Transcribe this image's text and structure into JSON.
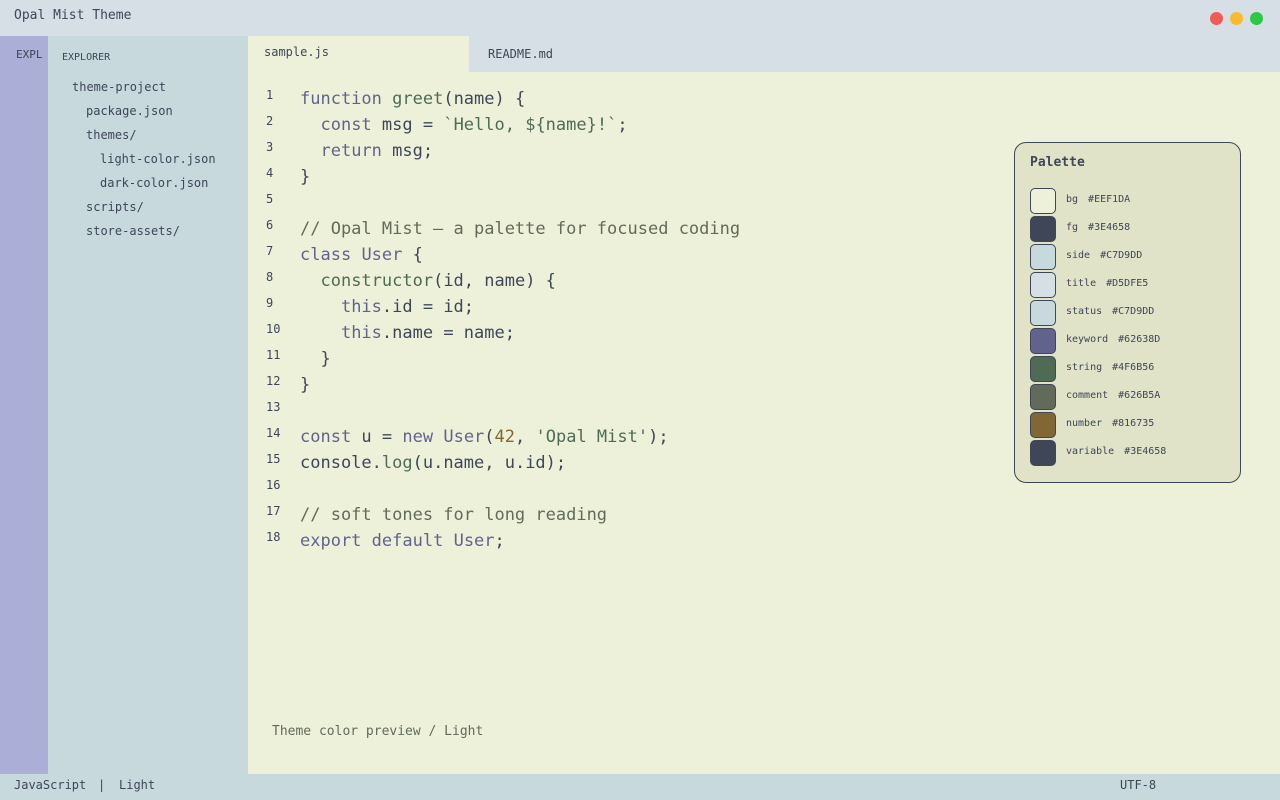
{
  "window": {
    "title": "Opal Mist Theme"
  },
  "activity_bar": {
    "label": "EXPL"
  },
  "sidebar": {
    "heading": "EXPLORER",
    "items": [
      {
        "label": "theme-project",
        "depth": 1
      },
      {
        "label": "package.json",
        "depth": 2
      },
      {
        "label": "themes/",
        "depth": 2
      },
      {
        "label": "light-color.json",
        "depth": 3
      },
      {
        "label": "dark-color.json",
        "depth": 3
      },
      {
        "label": "scripts/",
        "depth": 2
      },
      {
        "label": "store-assets/",
        "depth": 2
      }
    ]
  },
  "tabs": [
    {
      "label": "sample.js",
      "active": true
    },
    {
      "label": "README.md",
      "active": false
    }
  ],
  "editor": {
    "lines": [
      {
        "n": "1",
        "tokens": [
          [
            "keyword",
            "function"
          ],
          [
            "plain",
            " "
          ],
          [
            "func",
            "greet"
          ],
          [
            "plain",
            "(name) {"
          ]
        ]
      },
      {
        "n": "2",
        "tokens": [
          [
            "plain",
            "  "
          ],
          [
            "keyword",
            "const"
          ],
          [
            "plain",
            " msg = "
          ],
          [
            "string",
            "`Hello, ${name}!`"
          ],
          [
            "plain",
            ";"
          ]
        ]
      },
      {
        "n": "3",
        "tokens": [
          [
            "plain",
            "  "
          ],
          [
            "keyword",
            "return"
          ],
          [
            "plain",
            " msg;"
          ]
        ]
      },
      {
        "n": "4",
        "tokens": [
          [
            "plain",
            "}"
          ]
        ]
      },
      {
        "n": "5",
        "tokens": []
      },
      {
        "n": "6",
        "tokens": [
          [
            "comment",
            "// Opal Mist — a palette for focused coding"
          ]
        ]
      },
      {
        "n": "7",
        "tokens": [
          [
            "keyword",
            "class"
          ],
          [
            "plain",
            " "
          ],
          [
            "keyword",
            "User"
          ],
          [
            "plain",
            " {"
          ]
        ]
      },
      {
        "n": "8",
        "tokens": [
          [
            "plain",
            "  "
          ],
          [
            "func",
            "constructor"
          ],
          [
            "plain",
            "(id, name) {"
          ]
        ]
      },
      {
        "n": "9",
        "tokens": [
          [
            "plain",
            "    "
          ],
          [
            "keyword",
            "this"
          ],
          [
            "plain",
            ".id = id;"
          ]
        ]
      },
      {
        "n": "10",
        "tokens": [
          [
            "plain",
            "    "
          ],
          [
            "keyword",
            "this"
          ],
          [
            "plain",
            ".name = name;"
          ]
        ]
      },
      {
        "n": "11",
        "tokens": [
          [
            "plain",
            "  }"
          ]
        ]
      },
      {
        "n": "12",
        "tokens": [
          [
            "plain",
            "}"
          ]
        ]
      },
      {
        "n": "13",
        "tokens": []
      },
      {
        "n": "14",
        "tokens": [
          [
            "keyword",
            "const"
          ],
          [
            "plain",
            " u = "
          ],
          [
            "keyword",
            "new"
          ],
          [
            "plain",
            " "
          ],
          [
            "keyword",
            "User"
          ],
          [
            "plain",
            "("
          ],
          [
            "number",
            "42"
          ],
          [
            "plain",
            ", "
          ],
          [
            "string",
            "'Opal Mist'"
          ],
          [
            "plain",
            ");"
          ]
        ]
      },
      {
        "n": "15",
        "tokens": [
          [
            "plain",
            "console."
          ],
          [
            "func",
            "log"
          ],
          [
            "plain",
            "(u.name, u.id);"
          ]
        ]
      },
      {
        "n": "16",
        "tokens": []
      },
      {
        "n": "17",
        "tokens": [
          [
            "comment",
            "// soft tones for long reading"
          ]
        ]
      },
      {
        "n": "18",
        "tokens": [
          [
            "keyword",
            "export"
          ],
          [
            "plain",
            " "
          ],
          [
            "keyword",
            "default"
          ],
          [
            "plain",
            " "
          ],
          [
            "keyword",
            "User"
          ],
          [
            "plain",
            ";"
          ]
        ]
      }
    ],
    "footer_note": "Theme color preview / Light"
  },
  "palette": {
    "title": "Palette",
    "swatches": [
      {
        "name": "bg",
        "hex": "#EEF1DA"
      },
      {
        "name": "fg",
        "hex": "#3E4658"
      },
      {
        "name": "side",
        "hex": "#C7D9DD"
      },
      {
        "name": "title",
        "hex": "#D5DFE5"
      },
      {
        "name": "status",
        "hex": "#C7D9DD"
      },
      {
        "name": "keyword",
        "hex": "#62638D"
      },
      {
        "name": "string",
        "hex": "#4F6B56"
      },
      {
        "name": "comment",
        "hex": "#626B5A"
      },
      {
        "name": "number",
        "hex": "#816735"
      },
      {
        "name": "variable",
        "hex": "#3E4658"
      }
    ]
  },
  "statusbar": {
    "language": "JavaScript",
    "separator": "|",
    "theme": "Light",
    "encoding": "UTF-8"
  }
}
